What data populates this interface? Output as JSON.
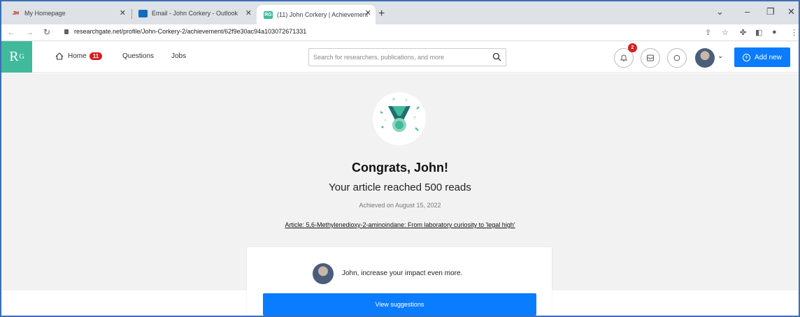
{
  "browser": {
    "tabs": [
      {
        "favicon": "JH",
        "title": "My Homepage"
      },
      {
        "favicon": "outlook-icon",
        "title": "Email - John Corkery - Outlook"
      },
      {
        "favicon": "RG",
        "title": "(11) John Corkery | Achievement"
      }
    ],
    "url": "researchgate.net/profile/John-Corkery-2/achievement/62f9e30ac94a103072671331"
  },
  "header": {
    "logo": "R",
    "logo_sup": "G",
    "nav": {
      "home": "Home",
      "home_badge": "11",
      "questions": "Questions",
      "jobs": "Jobs"
    },
    "search_placeholder": "Search for researchers, publications, and more",
    "notification_count": "2",
    "add_new": "Add new"
  },
  "achievement": {
    "title": "Congrats, John!",
    "subtitle": "Your article reached 500 reads",
    "date": "Achieved on August 15, 2022",
    "article_link": "Article: 5,6-Methylenedioxy-2-aminoindane: From laboratory curiosity to 'legal high'"
  },
  "card": {
    "message": "John, increase your impact even more.",
    "button": "View suggestions"
  },
  "colors": {
    "accent": "#0a7cff",
    "brand": "#40ba9b",
    "badge": "#d81e1e"
  }
}
